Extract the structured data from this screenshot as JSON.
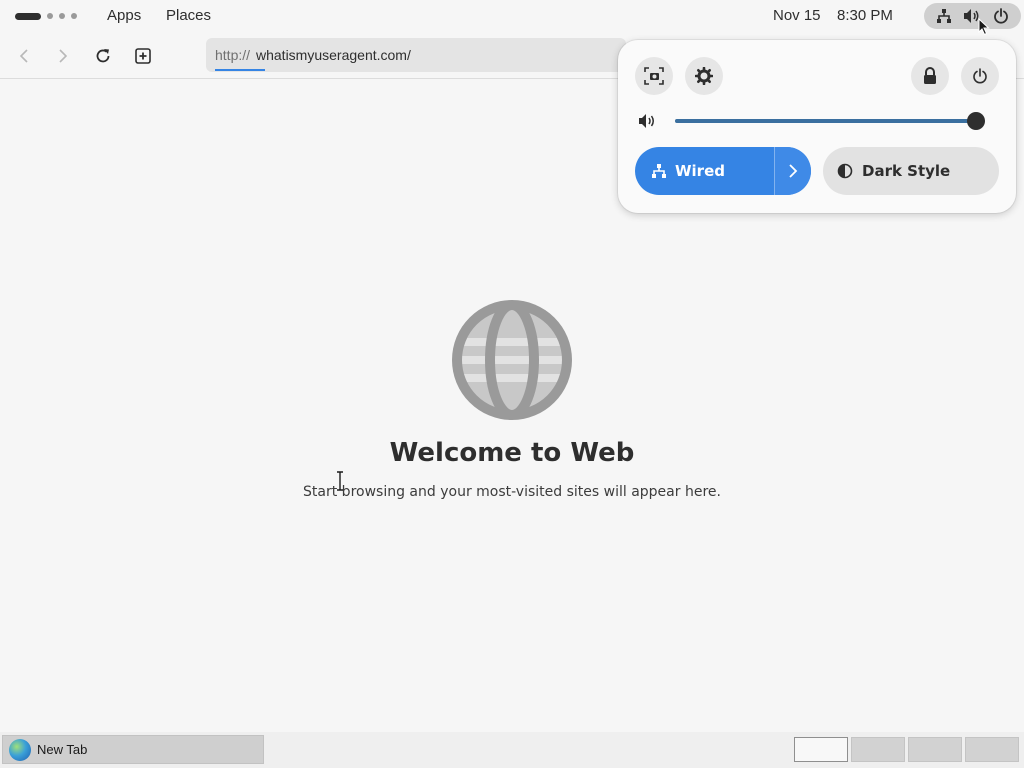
{
  "topbar": {
    "activities_icon": "activities-workspace-dots",
    "menus": [
      "Apps",
      "Places"
    ],
    "date": "Nov 15",
    "time": "8:30 PM",
    "status_icons": [
      "network-wired-icon",
      "volume-icon",
      "power-icon"
    ]
  },
  "browser": {
    "nav_icons": [
      "back-icon",
      "forward-icon",
      "reload-icon",
      "new-tab-icon"
    ],
    "url_scheme": "http://",
    "url_host": "whatismyuseragent.com/",
    "load_progress": 0.12,
    "welcome_title": "Welcome to Web",
    "welcome_subtitle": "Start browsing and your most-visited sites will appear here.",
    "globe_icon": "globe-icon"
  },
  "quick_settings": {
    "buttons": [
      "screenshot-icon",
      "settings-icon",
      "lock-icon",
      "power-icon"
    ],
    "volume_level": 1.0,
    "wired_label": "Wired",
    "wired_on": true,
    "dark_style_label": "Dark Style",
    "dark_style_on": false,
    "accent_color": "#3584e4"
  },
  "taskbar": {
    "window_label": "New Tab",
    "window_icon": "epiphany-globe-icon",
    "workspaces": 4,
    "active_workspace": 1
  }
}
